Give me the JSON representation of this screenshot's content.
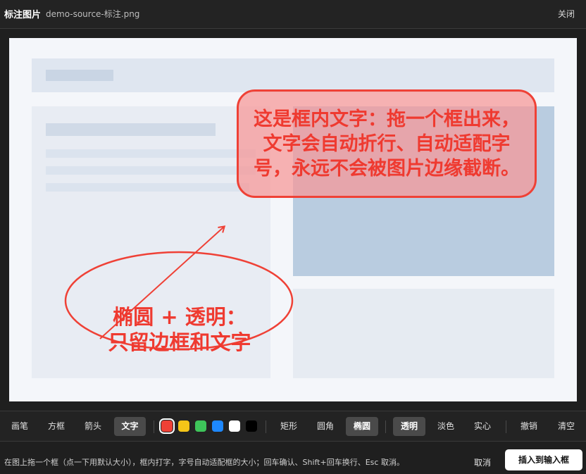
{
  "header": {
    "title": "标注图片",
    "filename": "demo-source-标注.png",
    "close_label": "关闭"
  },
  "annotations": {
    "text_box": "这是框内文字：拖一个框出来，文字会自动折行、自动适配字号，永远不会被图片边缘截断。",
    "ellipse_line1": "椭圆 + 透明：",
    "ellipse_line2": "只留边框和文字",
    "annotation_color": "#ef4136"
  },
  "toolbar": {
    "tools": [
      "画笔",
      "方框",
      "箭头",
      "文字"
    ],
    "active_tool": "文字",
    "colors": [
      "#ef4136",
      "#f5c518",
      "#3ec45a",
      "#1e88ff",
      "#ffffff",
      "#000000"
    ],
    "selected_color": "#ef4136",
    "shapes": [
      "矩形",
      "圆角",
      "椭圆"
    ],
    "active_shape": "椭圆",
    "fills": [
      "透明",
      "淡色",
      "实心"
    ],
    "active_fill": "透明",
    "undo_label": "撤销",
    "clear_label": "清空"
  },
  "footer": {
    "hint": "在图上拖一个框（点一下用默认大小），框内打字，字号自动适配框的大小；回车确认、Shift+回车换行、Esc 取消。",
    "cancel_label": "取消",
    "insert_label": "插入到输入框"
  }
}
